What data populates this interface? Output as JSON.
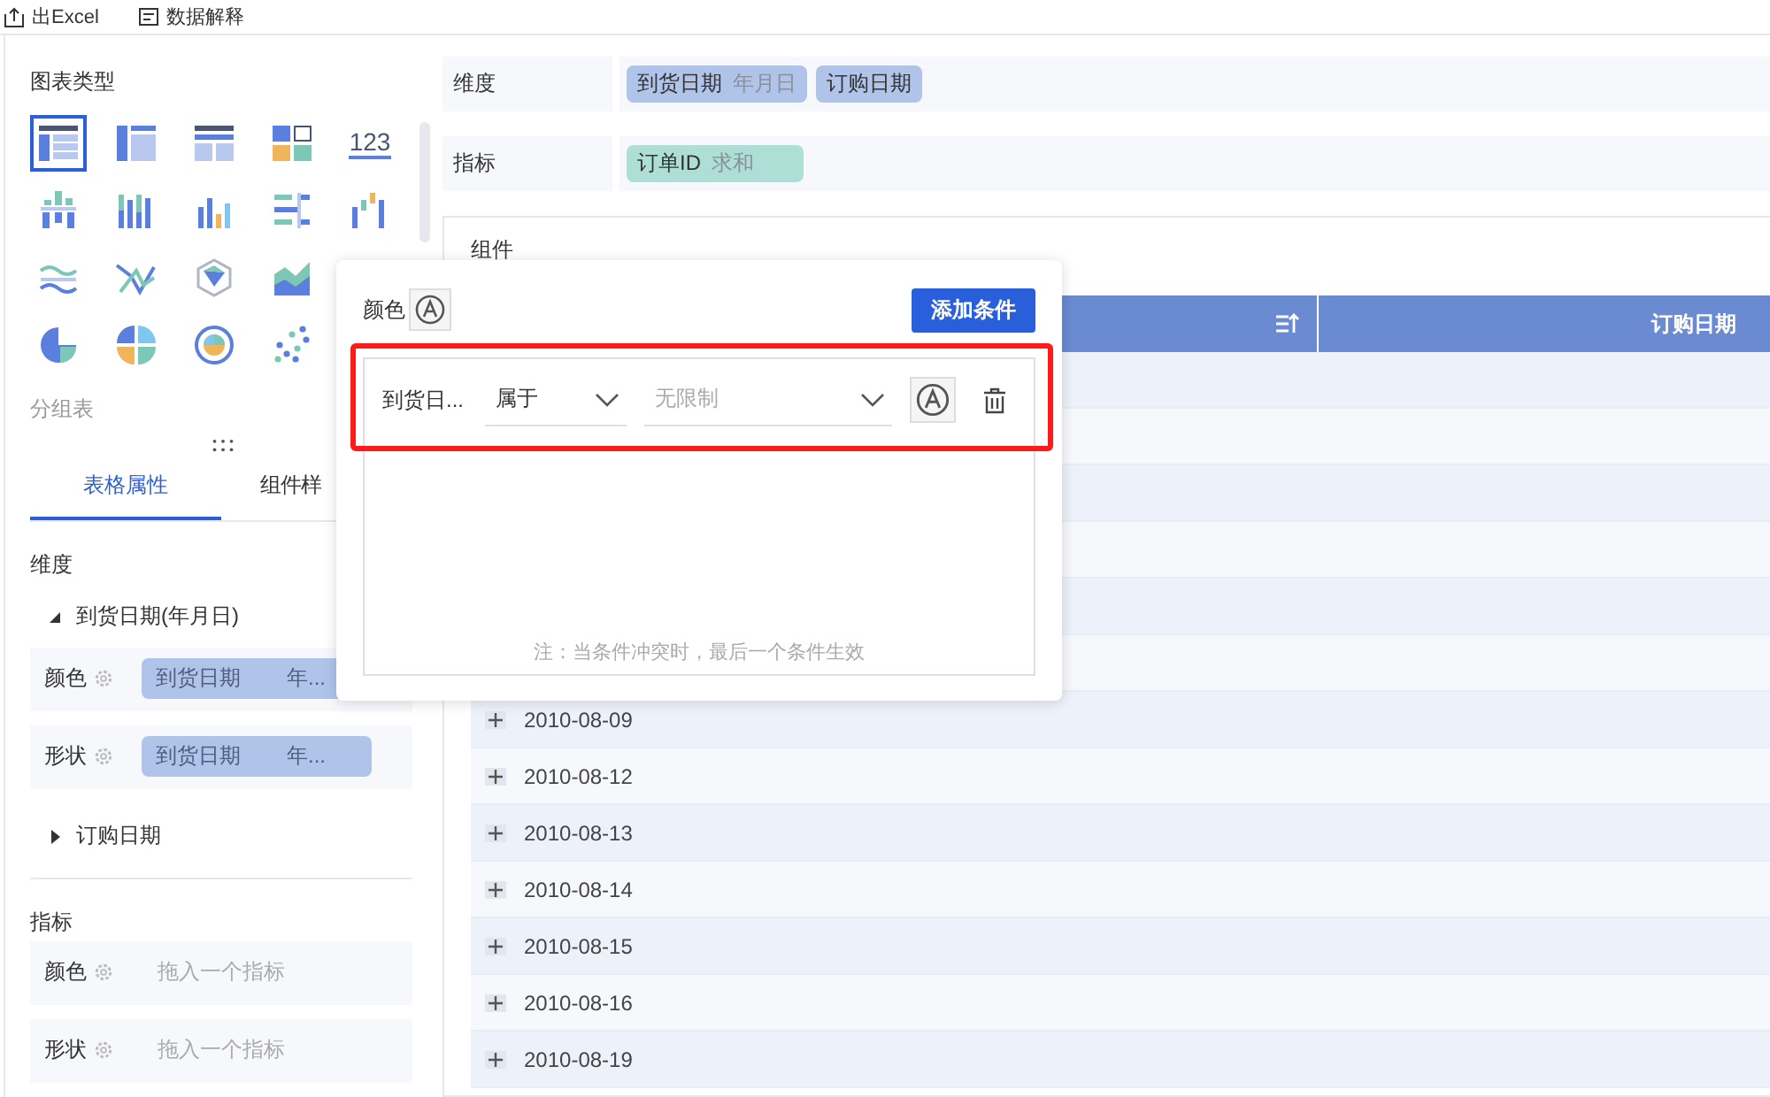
{
  "toolbar": [
    {
      "label": "出Excel"
    },
    {
      "label": "数据解释"
    }
  ],
  "chart_types": {
    "title": "图表类型",
    "rows": [
      [
        {
          "kind": "table",
          "selected": true
        },
        {
          "kind": "split-table",
          "selected": false
        },
        {
          "kind": "grid-table",
          "selected": false
        },
        {
          "kind": "kpi-card",
          "selected": false
        },
        {
          "kind": "number",
          "label": "123",
          "selected": false
        }
      ],
      [
        {
          "kind": "grouped-bar",
          "selected": false
        },
        {
          "kind": "stacked-bar",
          "selected": false
        },
        {
          "kind": "column-bar",
          "selected": false
        },
        {
          "kind": "horizontal-bar",
          "selected": false
        },
        {
          "kind": "waterfall",
          "selected": false
        }
      ],
      [
        {
          "kind": "wave-line",
          "selected": false
        },
        {
          "kind": "cross-line",
          "selected": false
        },
        {
          "kind": "radar",
          "selected": false
        },
        {
          "kind": "area",
          "selected": false
        }
      ],
      [
        {
          "kind": "pie",
          "selected": false
        },
        {
          "kind": "quad-pie",
          "selected": false
        },
        {
          "kind": "ring",
          "selected": false
        },
        {
          "kind": "scatter",
          "selected": false
        }
      ]
    ],
    "caption": "分组表"
  },
  "tabs": [
    {
      "label": "表格属性",
      "selected": true
    },
    {
      "label": "组件样",
      "selected": false
    }
  ],
  "dimension_section": {
    "title": "维度",
    "groups": [
      {
        "label": "到货日期(年月日)",
        "expanded": true,
        "rows": [
          {
            "label": "颜色",
            "field": "到货日期",
            "sub": "年..."
          },
          {
            "label": "形状",
            "field": "到货日期",
            "sub": "年..."
          }
        ]
      },
      {
        "label": "订购日期",
        "expanded": false
      }
    ]
  },
  "measure_section": {
    "title": "指标",
    "rows": [
      {
        "label": "颜色",
        "placeholder": "拖入一个指标"
      },
      {
        "label": "形状",
        "placeholder": "拖入一个指标"
      }
    ]
  },
  "shelves": [
    {
      "label": "维度",
      "pills": [
        {
          "kind": "dimension",
          "name": "到货日期",
          "sub": "年月日"
        },
        {
          "kind": "dimension",
          "name": "订购日期"
        }
      ]
    },
    {
      "label": "指标",
      "pills": [
        {
          "kind": "measure",
          "name": "订单ID",
          "sub": "求和"
        }
      ]
    }
  ],
  "component": {
    "title": "组件",
    "columns": [
      {
        "sortable": true
      },
      {
        "label": "订购日期",
        "sortable": false
      }
    ],
    "rows": [
      {
        "date": "2010-08-09",
        "expanded": false
      },
      {
        "date": "2010-08-12",
        "expanded": false
      },
      {
        "date": "2010-08-13",
        "expanded": false
      },
      {
        "date": "2010-08-14",
        "expanded": false
      },
      {
        "date": "2010-08-15",
        "expanded": false
      },
      {
        "date": "2010-08-16",
        "expanded": false
      },
      {
        "date": "2010-08-19",
        "expanded": false
      }
    ]
  },
  "popup": {
    "label": "颜色",
    "add_button": "添加条件",
    "conditions": [
      {
        "field": "到货日...",
        "operator": "属于",
        "value_placeholder": "无限制",
        "highlighted": true
      }
    ],
    "note": "注：当条件冲突时，最后一个条件生效"
  }
}
